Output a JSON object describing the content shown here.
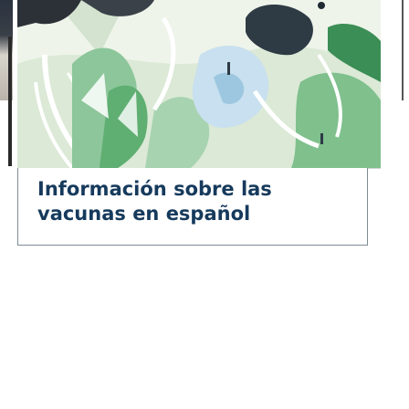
{
  "carousel": {
    "current_card": {
      "caption": "Información sobre las vacunas en español",
      "image_icon": "vaccine-illustration"
    }
  }
}
